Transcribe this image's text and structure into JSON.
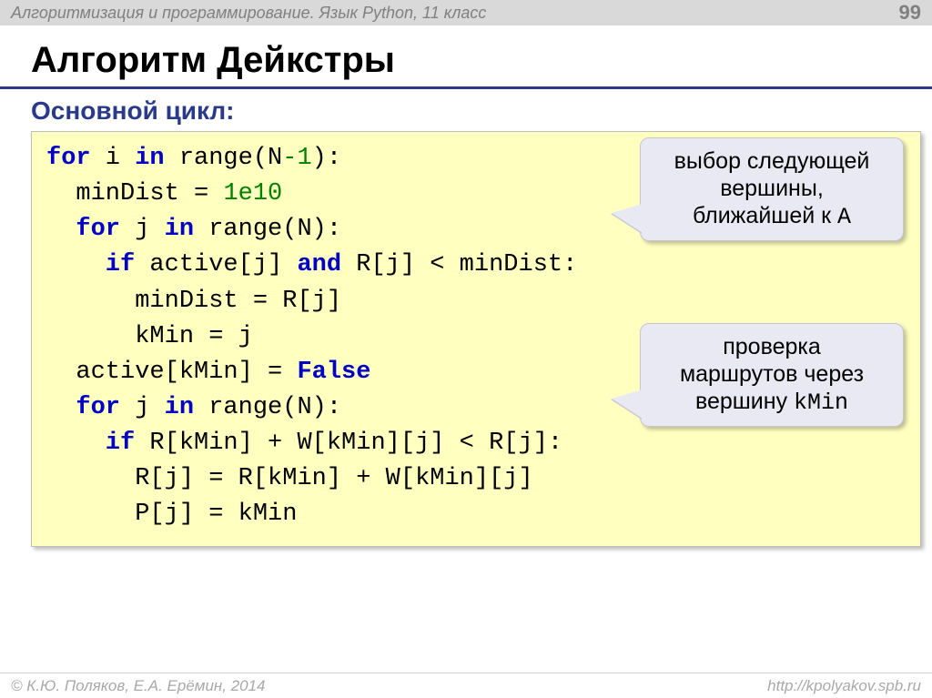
{
  "header": {
    "breadcrumb": "Алгоритмизация и программирование. Язык Python, 11 класс",
    "page_number": "99"
  },
  "title": "Алгоритм Дейкстры",
  "subtitle": "Основной цикл:",
  "code": {
    "l1": {
      "kw1": "for",
      "t1": " i ",
      "kw2": "in",
      "t2": " range(N",
      "num": "-1",
      "t3": "):"
    },
    "l2": {
      "t1": "  minDist = ",
      "num": "1e10"
    },
    "l3": {
      "kw1": "  for",
      "t1": " j ",
      "kw2": "in",
      "t2": " range(N):"
    },
    "l4": {
      "kw1": "    if",
      "t1": " active[j] ",
      "kw2": "and",
      "t2": " R[j] < minDist:"
    },
    "l5": {
      "t1": "      minDist = R[j]"
    },
    "l6": {
      "t1": "      kMin = j"
    },
    "l7": {
      "t1": "  active[kMin] = ",
      "bool": "False"
    },
    "l8": {
      "kw1": "  for",
      "t1": " j ",
      "kw2": "in",
      "t2": " range(N):"
    },
    "l9": {
      "kw1": "    if",
      "t1": " R[kMin] + W[kMin][j] < R[j]:"
    },
    "l10": {
      "t1": "      R[j] = R[kMin] + W[kMin][j]"
    },
    "l11": {
      "t1": "      P[j] = kMin"
    }
  },
  "callouts": {
    "c1": {
      "line1": "выбор следующей",
      "line2": "вершины,",
      "line3_a": "ближайшей к ",
      "line3_mono": "A"
    },
    "c2": {
      "line1": "проверка",
      "line2": "маршрутов через",
      "line3_a": "вершину ",
      "line3_mono": "kMin"
    }
  },
  "footer": {
    "left": "© К.Ю. Поляков, Е.А. Ерёмин, 2014",
    "right": "http://kpolyakov.spb.ru"
  }
}
